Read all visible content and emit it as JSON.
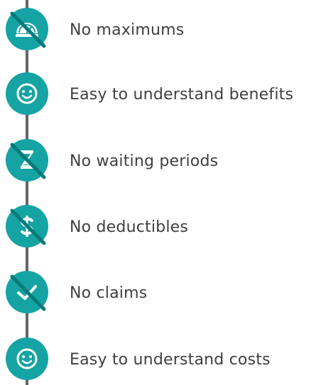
{
  "colors": {
    "badge_fill": "#15A3A3",
    "slash": "#087A7A",
    "timeline": "#666666",
    "text": "#3f3f3f"
  },
  "features": [
    {
      "icon": "speedometer-icon",
      "negated": true,
      "label": "No maximums"
    },
    {
      "icon": "smiley-icon",
      "negated": false,
      "label": "Easy to understand benefits"
    },
    {
      "icon": "hourglass-icon",
      "negated": true,
      "label": "No waiting periods"
    },
    {
      "icon": "dollar-sign-icon",
      "negated": true,
      "label": "No deductibles"
    },
    {
      "icon": "checkmark-icon",
      "negated": true,
      "label": "No claims"
    },
    {
      "icon": "smiley-icon",
      "negated": false,
      "label": "Easy to understand costs"
    }
  ]
}
